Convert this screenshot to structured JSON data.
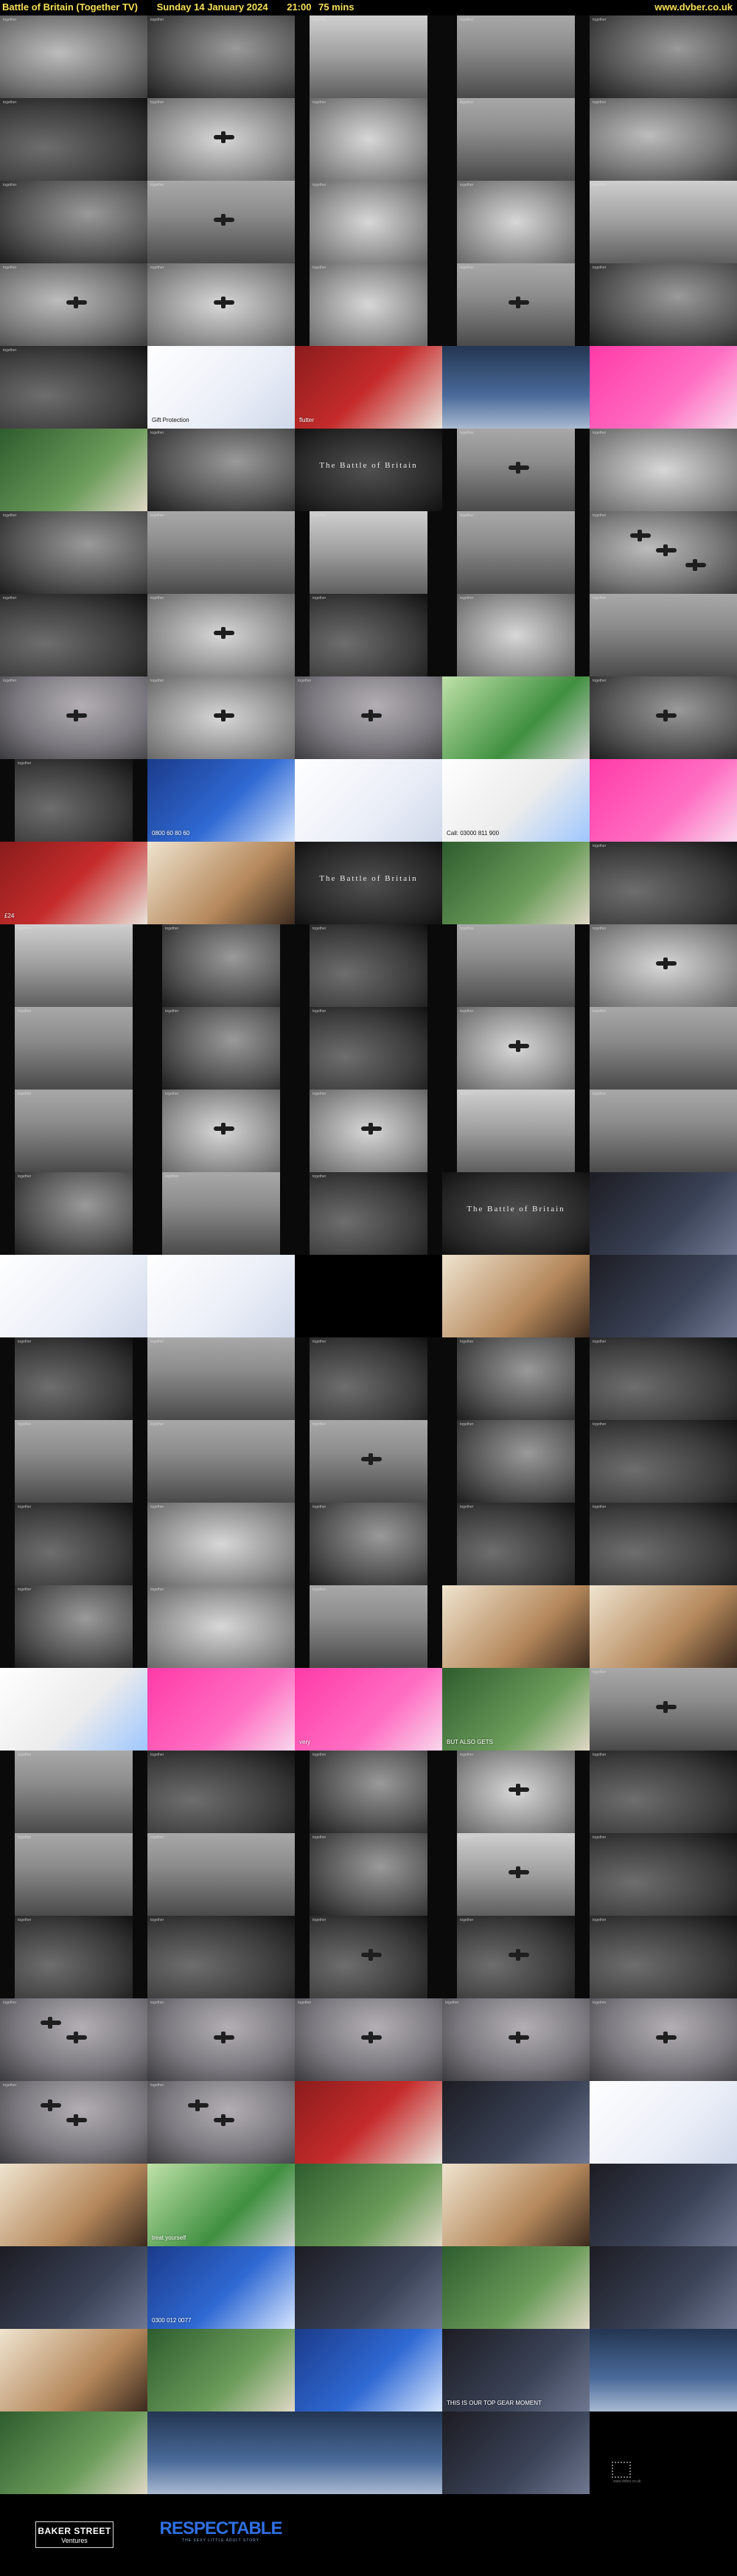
{
  "header": {
    "title": "Battle of Britain (Together TV)",
    "date": "Sunday 14 January 2024",
    "time": "21:00",
    "duration": "75 mins",
    "site": "www.dvber.co.uk"
  },
  "colors": {
    "header_text": "#f7e05a",
    "background": "#000000",
    "respectable_blue": "#2f6fe2"
  },
  "channel_logo": "together",
  "thumbnails": [
    {
      "kind": "archive",
      "tone": 0
    },
    {
      "kind": "archive",
      "tone": 1
    },
    {
      "kind": "archive-pillar",
      "tone": 2
    },
    {
      "kind": "archive-pillar",
      "tone": 4
    },
    {
      "kind": "archive",
      "tone": 1
    },
    {
      "kind": "archive",
      "tone": 3
    },
    {
      "kind": "archive",
      "tone": 5,
      "planes": 1
    },
    {
      "kind": "archive-pillar",
      "tone": 5
    },
    {
      "kind": "archive-pillar",
      "tone": 4
    },
    {
      "kind": "archive",
      "tone": 0
    },
    {
      "kind": "archive",
      "tone": 1
    },
    {
      "kind": "archive",
      "tone": 4,
      "planes": 1
    },
    {
      "kind": "archive-pillar",
      "tone": 5
    },
    {
      "kind": "archive-pillar",
      "tone": 5
    },
    {
      "kind": "archive",
      "tone": 2
    },
    {
      "kind": "archive",
      "tone": 0,
      "planes": 1
    },
    {
      "kind": "archive",
      "tone": 5,
      "planes": 1
    },
    {
      "kind": "archive-pillar",
      "tone": 5
    },
    {
      "kind": "archive-pillar",
      "tone": 4,
      "planes": 1
    },
    {
      "kind": "archive",
      "tone": 1
    },
    {
      "kind": "archive",
      "tone": 3
    },
    {
      "kind": "ad",
      "ad": 0,
      "dark": true,
      "text": "Gift Protection"
    },
    {
      "kind": "ad",
      "ad": 1,
      "text": "flutter"
    },
    {
      "kind": "ad",
      "ad": 9,
      "text": ""
    },
    {
      "kind": "ad",
      "ad": 2,
      "text": ""
    },
    {
      "kind": "ad",
      "ad": 8,
      "text": ""
    },
    {
      "kind": "archive",
      "tone": 1
    },
    {
      "kind": "title",
      "text": "The Battle of Britain"
    },
    {
      "kind": "archive-pillar",
      "tone": 4,
      "planes": 1
    },
    {
      "kind": "archive",
      "tone": 5
    },
    {
      "kind": "archive",
      "tone": 1
    },
    {
      "kind": "archive",
      "tone": 4
    },
    {
      "kind": "archive-pillar",
      "tone": 2
    },
    {
      "kind": "archive-pillar",
      "tone": 4
    },
    {
      "kind": "archive",
      "tone": 0,
      "planes": 3
    },
    {
      "kind": "archive",
      "tone": 3
    },
    {
      "kind": "archive",
      "tone": 5,
      "planes": 1
    },
    {
      "kind": "archive-pillar",
      "tone": 3
    },
    {
      "kind": "archive-pillar",
      "tone": 5
    },
    {
      "kind": "archive",
      "tone": 4
    },
    {
      "kind": "archive",
      "tone": 6,
      "planes": 1
    },
    {
      "kind": "archive",
      "tone": 5,
      "planes": 1
    },
    {
      "kind": "archive",
      "tone": 6,
      "planes": 1
    },
    {
      "kind": "ad",
      "ad": 4,
      "text": ""
    },
    {
      "kind": "archive",
      "tone": 1,
      "planes": 1
    },
    {
      "kind": "archive-pillar",
      "tone": 3
    },
    {
      "kind": "ad",
      "ad": 3,
      "text": "0800 60 80 60"
    },
    {
      "kind": "ad",
      "ad": 0,
      "dark": true,
      "text": ""
    },
    {
      "kind": "ad",
      "ad": 6,
      "dark": true,
      "text": "Call: 03000 811 900"
    },
    {
      "kind": "ad",
      "ad": 2,
      "text": ""
    },
    {
      "kind": "ad",
      "ad": 1,
      "text": "£24"
    },
    {
      "kind": "ad",
      "ad": 5,
      "text": ""
    },
    {
      "kind": "title",
      "text": "The Battle of Britain"
    },
    {
      "kind": "ad",
      "ad": 8,
      "text": ""
    },
    {
      "kind": "archive",
      "tone": 3
    },
    {
      "kind": "archive-pillar",
      "tone": 2
    },
    {
      "kind": "archive-pillar",
      "tone": 1
    },
    {
      "kind": "archive-pillar",
      "tone": 3
    },
    {
      "kind": "archive-pillar",
      "tone": 4
    },
    {
      "kind": "archive",
      "tone": 5,
      "planes": 1
    },
    {
      "kind": "archive-pillar",
      "tone": 4
    },
    {
      "kind": "archive-pillar",
      "tone": 1
    },
    {
      "kind": "archive-pillar",
      "tone": 3
    },
    {
      "kind": "archive-pillar",
      "tone": 5,
      "planes": 1
    },
    {
      "kind": "archive",
      "tone": 4
    },
    {
      "kind": "archive-pillar",
      "tone": 4
    },
    {
      "kind": "archive-pillar",
      "tone": 5,
      "planes": 1
    },
    {
      "kind": "archive-pillar",
      "tone": 5,
      "planes": 1
    },
    {
      "kind": "archive-pillar",
      "tone": 2
    },
    {
      "kind": "archive",
      "tone": 4
    },
    {
      "kind": "archive-pillar",
      "tone": 1
    },
    {
      "kind": "archive-pillar",
      "tone": 4
    },
    {
      "kind": "archive-pillar",
      "tone": 3
    },
    {
      "kind": "title",
      "text": "The Battle of Britain"
    },
    {
      "kind": "ad",
      "ad": 7,
      "text": ""
    },
    {
      "kind": "ad",
      "ad": 0,
      "dark": true,
      "text": ""
    },
    {
      "kind": "ad",
      "ad": 0,
      "dark": true,
      "text": ""
    },
    {
      "kind": "black",
      "text": ""
    },
    {
      "kind": "ad",
      "ad": 5,
      "text": ""
    },
    {
      "kind": "ad",
      "ad": 7,
      "text": ""
    },
    {
      "kind": "archive-pillar",
      "tone": 3
    },
    {
      "kind": "archive",
      "tone": 4
    },
    {
      "kind": "archive-pillar",
      "tone": 3
    },
    {
      "kind": "archive-pillar",
      "tone": 1
    },
    {
      "kind": "archive",
      "tone": 3
    },
    {
      "kind": "archive-pillar",
      "tone": 4
    },
    {
      "kind": "archive",
      "tone": 4
    },
    {
      "kind": "archive-pillar",
      "tone": 4,
      "planes": 1
    },
    {
      "kind": "archive-pillar",
      "tone": 1
    },
    {
      "kind": "archive",
      "tone": 3
    },
    {
      "kind": "archive-pillar",
      "tone": 3
    },
    {
      "kind": "archive",
      "tone": 5
    },
    {
      "kind": "archive-pillar",
      "tone": 1
    },
    {
      "kind": "archive-pillar",
      "tone": 3
    },
    {
      "kind": "archive",
      "tone": 3
    },
    {
      "kind": "archive-pillar",
      "tone": 1
    },
    {
      "kind": "archive",
      "tone": 5
    },
    {
      "kind": "archive-pillar",
      "tone": 4
    },
    {
      "kind": "ad",
      "ad": 5,
      "text": ""
    },
    {
      "kind": "ad",
      "ad": 5,
      "text": ""
    },
    {
      "kind": "ad",
      "ad": 6,
      "dark": true,
      "text": ""
    },
    {
      "kind": "ad",
      "ad": 2,
      "text": ""
    },
    {
      "kind": "ad",
      "ad": 2,
      "text": "very"
    },
    {
      "kind": "ad",
      "ad": 8,
      "text": "BUT ALSO GETS"
    },
    {
      "kind": "archive",
      "tone": 4,
      "planes": 1
    },
    {
      "kind": "archive-pillar",
      "tone": 4
    },
    {
      "kind": "archive",
      "tone": 3
    },
    {
      "kind": "archive-pillar",
      "tone": 1
    },
    {
      "kind": "archive-pillar",
      "tone": 5,
      "planes": 1
    },
    {
      "kind": "archive",
      "tone": 3
    },
    {
      "kind": "archive-pillar",
      "tone": 4
    },
    {
      "kind": "archive",
      "tone": 4
    },
    {
      "kind": "archive-pillar",
      "tone": 1
    },
    {
      "kind": "archive-pillar",
      "tone": 2,
      "planes": 1
    },
    {
      "kind": "archive",
      "tone": 3
    },
    {
      "kind": "archive-pillar",
      "tone": 3
    },
    {
      "kind": "archive",
      "tone": 3
    },
    {
      "kind": "archive-pillar",
      "tone": 3,
      "planes": 1
    },
    {
      "kind": "archive-pillar",
      "tone": 3,
      "planes": 1
    },
    {
      "kind": "archive",
      "tone": 3
    },
    {
      "kind": "archive",
      "tone": 6,
      "planes": 2
    },
    {
      "kind": "archive",
      "tone": 6,
      "planes": 1
    },
    {
      "kind": "archive",
      "tone": 6,
      "planes": 1
    },
    {
      "kind": "archive",
      "tone": 6,
      "planes": 1
    },
    {
      "kind": "archive",
      "tone": 6,
      "planes": 1
    },
    {
      "kind": "archive",
      "tone": 6,
      "planes": 2
    },
    {
      "kind": "archive",
      "tone": 6,
      "planes": 2
    },
    {
      "kind": "ad",
      "ad": 1,
      "text": ""
    },
    {
      "kind": "ad",
      "ad": 7,
      "text": ""
    },
    {
      "kind": "ad",
      "ad": 0,
      "dark": true,
      "text": ""
    },
    {
      "kind": "ad",
      "ad": 5,
      "text": ""
    },
    {
      "kind": "ad",
      "ad": 4,
      "text": "treat yourself"
    },
    {
      "kind": "ad",
      "ad": 8,
      "text": ""
    },
    {
      "kind": "ad",
      "ad": 5,
      "text": ""
    },
    {
      "kind": "ad",
      "ad": 7,
      "text": ""
    },
    {
      "kind": "ad",
      "ad": 7,
      "text": ""
    },
    {
      "kind": "ad",
      "ad": 3,
      "text": "0300 012 0077"
    },
    {
      "kind": "ad",
      "ad": 7,
      "text": ""
    },
    {
      "kind": "ad",
      "ad": 8,
      "text": ""
    },
    {
      "kind": "ad",
      "ad": 7,
      "text": ""
    },
    {
      "kind": "ad",
      "ad": 5,
      "text": ""
    },
    {
      "kind": "ad",
      "ad": 8,
      "text": ""
    },
    {
      "kind": "ad",
      "ad": 3,
      "text": ""
    },
    {
      "kind": "ad",
      "ad": 7,
      "text": "THIS IS OUR TOP GEAR MOMENT"
    },
    {
      "kind": "ad",
      "ad": 9,
      "text": ""
    },
    {
      "kind": "ad",
      "ad": 8,
      "text": ""
    },
    {
      "kind": "ad",
      "ad": 9,
      "text": ""
    },
    {
      "kind": "ad",
      "ad": 9,
      "text": ""
    },
    {
      "kind": "ad",
      "ad": 7,
      "text": ""
    },
    {
      "kind": "black",
      "text": "www.dvber.co.uk"
    }
  ],
  "footer": {
    "baker_street_line1": "BAKER STREET",
    "baker_street_line2": "Ventures",
    "respectable_title": "RESPECTABLE",
    "respectable_tagline": "THE SEXY LITTLE ADULT STORY"
  }
}
